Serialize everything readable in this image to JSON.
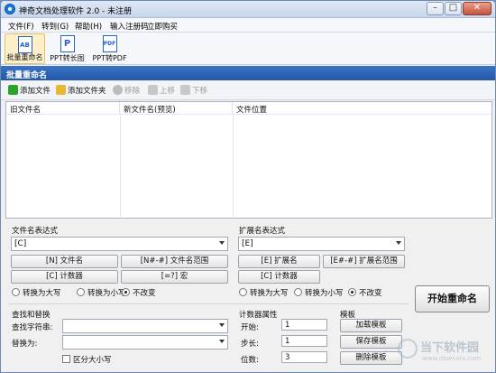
{
  "window": {
    "title": "神奇文档处理软件 2.0 - 未注册"
  },
  "menu": [
    "文件(F)",
    "转到(G)",
    "帮助(H)",
    "输入注册码",
    "立即购买"
  ],
  "toolbar": [
    {
      "label": "批量重命名",
      "icon": "AB"
    },
    {
      "label": "PPT转长图",
      "icon": "P"
    },
    {
      "label": "PPT转PDF",
      "icon": "PDF"
    }
  ],
  "section_title": "批量重命名",
  "commands": {
    "add_file": "添加文件",
    "add_folder": "添加文件夹",
    "remove": "移除",
    "move_up": "上移",
    "move_down": "下移"
  },
  "grid": {
    "columns": [
      "旧文件名",
      "新文件名(预览)",
      "文件位置"
    ]
  },
  "filename_expr": {
    "label": "文件名表达式",
    "value": "[C]",
    "btn_name": "[N] 文件名",
    "btn_range": "[N#-#] 文件名范围",
    "btn_counter": "[C] 计数器",
    "btn_macro": "[=?] 宏"
  },
  "ext_expr": {
    "label": "扩展名表达式",
    "value": "[E]",
    "btn_ext": "[E] 扩展名",
    "btn_range": "[E#-#] 扩展名范围",
    "btn_counter": "[C] 计数器"
  },
  "case_options": {
    "upper": "转换为大写",
    "lower": "转换为小写",
    "unchanged": "不改变"
  },
  "find_replace": {
    "title": "查找和替换",
    "find_label": "查找字符串:",
    "replace_label": "替换为:",
    "case_sensitive": "区分大小写",
    "find_value": "",
    "replace_value": ""
  },
  "counter": {
    "title": "计数器属性",
    "start_label": "开始:",
    "start": "1",
    "step_label": "步长:",
    "step": "1",
    "digits_label": "位数:",
    "digits": "3"
  },
  "template": {
    "title": "模板",
    "load": "加载模板",
    "save": "保存模板",
    "delete": "删除模板"
  },
  "start_button": "开始重命名",
  "watermark": {
    "brand": "当下软件园",
    "url": "www.downxia.com"
  },
  "colors": {
    "accent": "#2357a8",
    "toolbar_active": "#fdf0c9",
    "add_green": "#2aa52a",
    "folder_yellow": "#e8b832"
  }
}
